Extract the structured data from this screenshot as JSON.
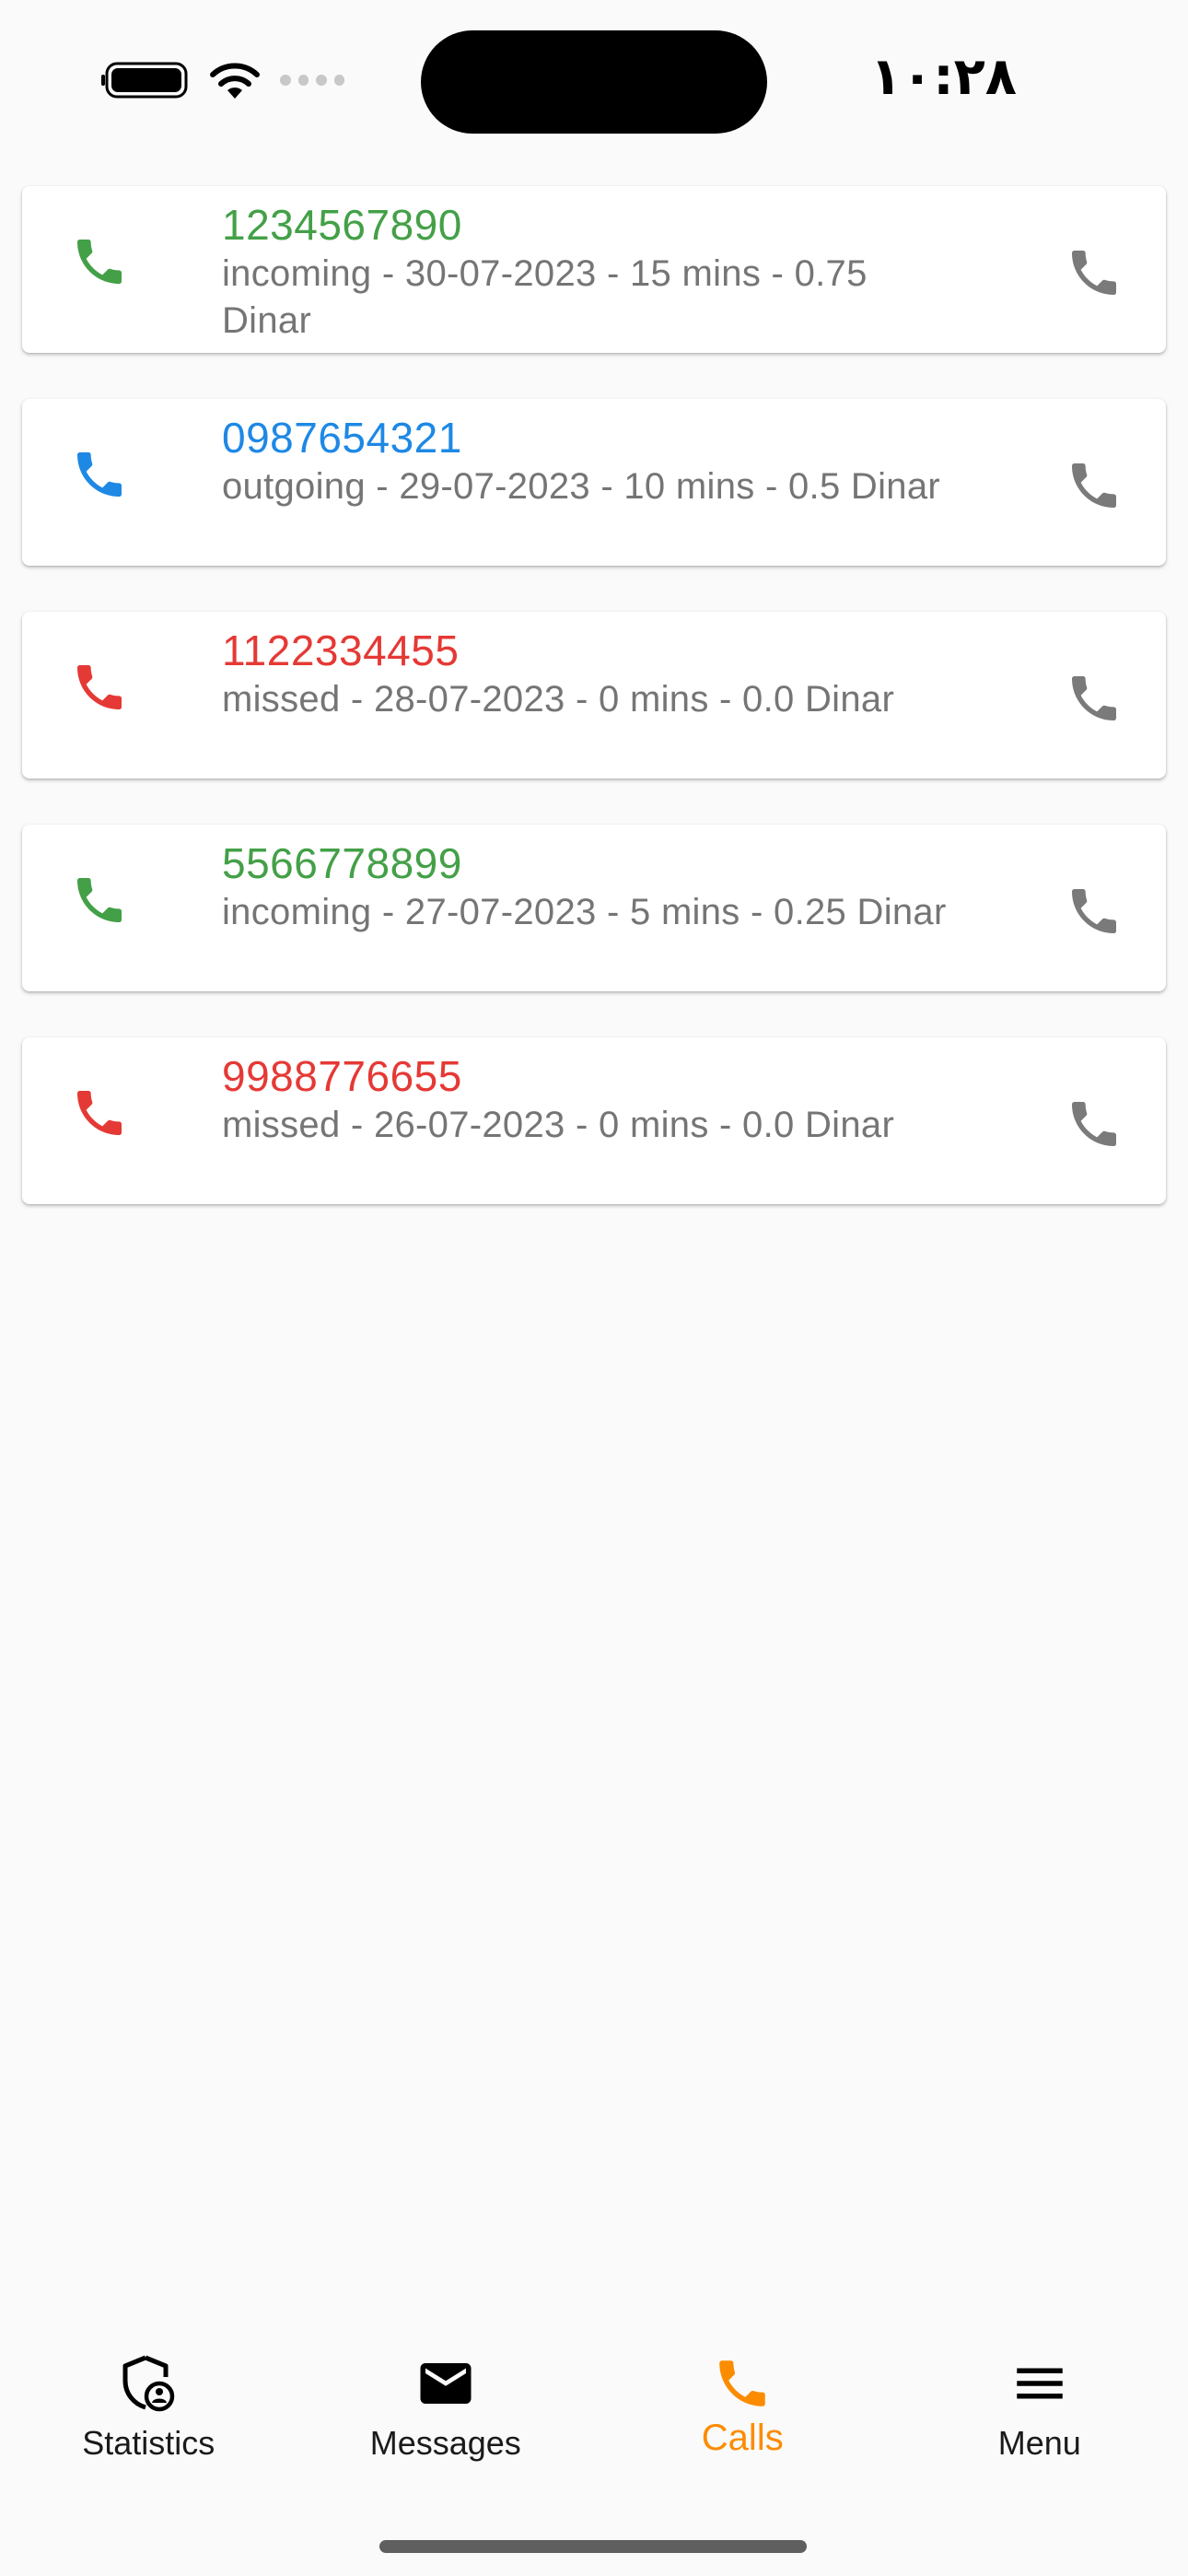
{
  "status_bar": {
    "time": "١٠:٢٨",
    "icons": [
      "battery-icon",
      "wifi-icon",
      "signal-icon"
    ]
  },
  "calls": [
    {
      "number": "1234567890",
      "details": "incoming - 30-07-2023 - 15 mins - 0.75 Dinar",
      "type": "incoming",
      "color": "#43a047"
    },
    {
      "number": "0987654321",
      "details": "outgoing - 29-07-2023 - 10 mins - 0.5 Dinar",
      "type": "outgoing",
      "color": "#1e88e5"
    },
    {
      "number": "1122334455",
      "details": "missed - 28-07-2023 - 0 mins - 0.0 Dinar",
      "type": "missed",
      "color": "#e53935"
    },
    {
      "number": "5566778899",
      "details": "incoming - 27-07-2023 - 5 mins - 0.25 Dinar",
      "type": "incoming",
      "color": "#43a047"
    },
    {
      "number": "9988776655",
      "details": "missed - 26-07-2023 - 0 mins - 0.0 Dinar",
      "type": "missed",
      "color": "#e53935"
    }
  ],
  "call_back_icon_color": "#7a7a7a",
  "bottom_nav": {
    "items": [
      {
        "label": "Statistics",
        "icon": "shield-user-icon",
        "active": false
      },
      {
        "label": "Messages",
        "icon": "mail-icon",
        "active": false
      },
      {
        "label": "Calls",
        "icon": "phone-icon",
        "active": true
      },
      {
        "label": "Menu",
        "icon": "menu-icon",
        "active": false
      }
    ],
    "active_color": "#fb8c00",
    "inactive_color": "#000000"
  }
}
